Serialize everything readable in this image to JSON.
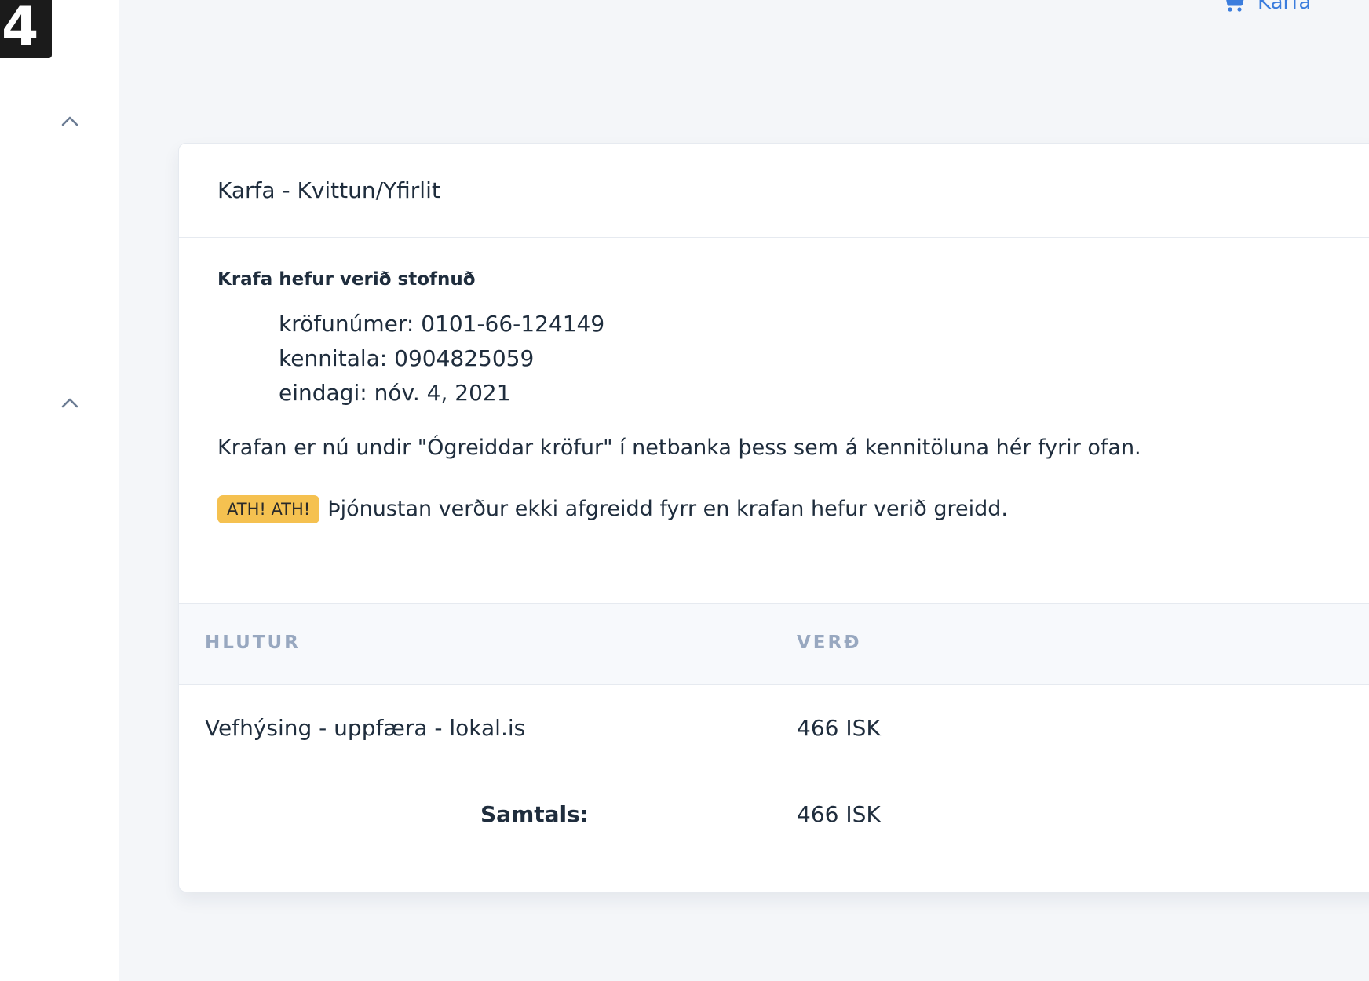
{
  "logo": {
    "text": "4"
  },
  "topbar": {
    "cart_label": "Karfa"
  },
  "card": {
    "title": "Karfa - Kvittun/Yfirlit",
    "subtitle": "Krafa hefur verið stofnuð",
    "details": [
      "kröfunúmer: 0101-66-124149",
      "kennitala: 0904825059",
      "eindagi: nóv. 4, 2021"
    ],
    "message": "Krafan er nú undir \"Ógreiddar kröfur\" í netbanka þess sem á kennitöluna hér fyrir ofan.",
    "warning": {
      "badge": "ATH! ATH!",
      "text": "Þjónustan verður ekki afgreidd fyrr en krafan hefur verið greidd."
    }
  },
  "table": {
    "headers": {
      "item": "HLUTUR",
      "price": "VERÐ"
    },
    "rows": [
      {
        "item": "Vefhýsing - uppfæra - lokal.is",
        "price": "466 ISK"
      }
    ],
    "total_label": "Samtals:",
    "total_value": "466 ISK"
  },
  "colors": {
    "accent": "#3b7ddd",
    "badge": "#f5c150",
    "table_header_text": "#98a8c0"
  },
  "icons": {
    "cart": "cart-icon",
    "collapse": "chevron-up-icon"
  }
}
